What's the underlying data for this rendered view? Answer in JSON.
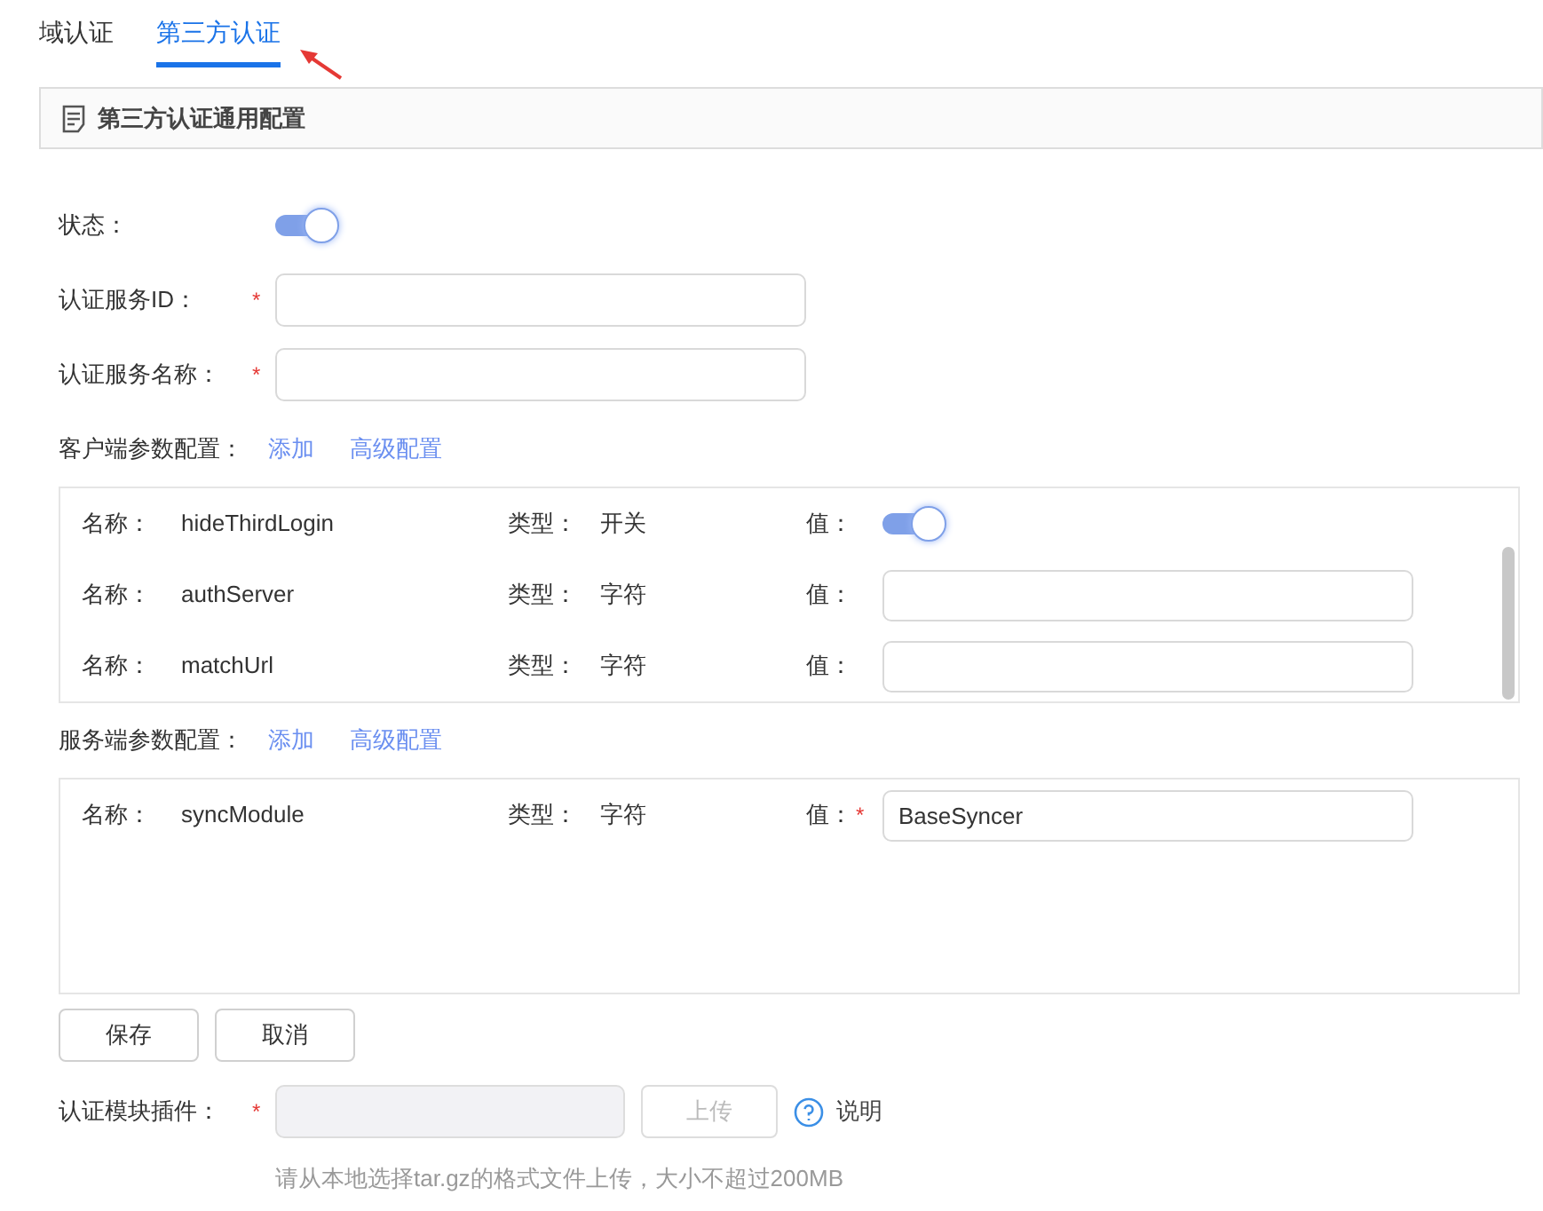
{
  "tabs": [
    {
      "label": "域认证",
      "selected": false
    },
    {
      "label": "第三方认证",
      "selected": true
    }
  ],
  "section_title": "第三方认证通用配置",
  "fields": [
    {
      "kind": "switch",
      "label": "状态：",
      "on": true
    },
    {
      "kind": "input",
      "label": "认证服务ID：",
      "required_mark": "*"
    },
    {
      "kind": "input",
      "label": "认证服务名称：",
      "required_mark": "*"
    }
  ],
  "param_groups": [
    {
      "label": "客户端参数配置：",
      "actions": [
        "添加",
        "高级配置"
      ],
      "params": [
        {
          "name_label": "名称：",
          "name": "hideThirdLogin",
          "type_label": "类型：",
          "type": "开关",
          "value_label": "值：",
          "kind": "switch",
          "on": true
        },
        {
          "name_label": "名称：",
          "name": "authServer",
          "type_label": "类型：",
          "type": "字符",
          "value_label": "值：",
          "kind": "input"
        },
        {
          "name_label": "名称：",
          "name": "matchUrl",
          "type_label": "类型：",
          "type": "字符",
          "value_label": "值：",
          "kind": "input"
        }
      ]
    },
    {
      "label": "服务端参数配置：",
      "actions": [
        "添加",
        "高级配置"
      ],
      "params": [
        {
          "name_label": "名称：",
          "name": "syncModule",
          "type_label": "类型：",
          "type": "字符",
          "value_label": "值：",
          "kind": "input",
          "required_mark": "*",
          "value": "BaseSyncer"
        }
      ]
    }
  ],
  "buttons": [
    "保存",
    "取消"
  ],
  "plugin": {
    "label": "认证模块插件：",
    "required_mark": "*",
    "disabled": true,
    "upload_label": "上传",
    "upload_disabled": true,
    "help": "说明",
    "hint": "请从本地选择tar.gz的格式文件上传，大小不超过200MB"
  }
}
